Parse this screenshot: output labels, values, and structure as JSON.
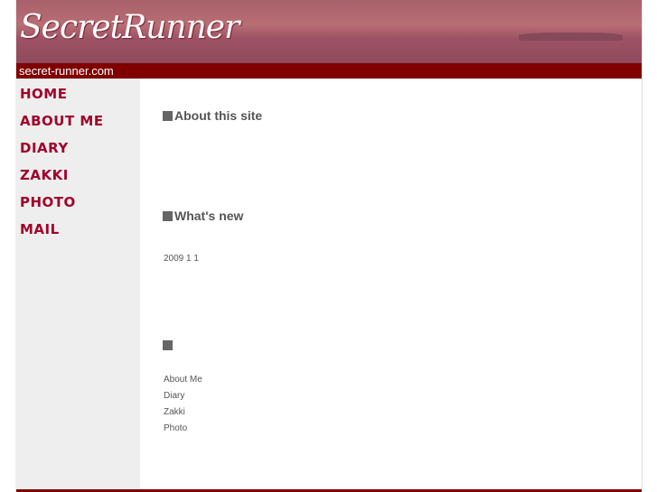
{
  "header": {
    "logo": "SecretRunner",
    "domain": "secret-runner.com"
  },
  "sidebar": {
    "items": [
      {
        "label": "HOME"
      },
      {
        "label": "ABOUT ME"
      },
      {
        "label": "DIARY"
      },
      {
        "label": "ZAKKI"
      },
      {
        "label": "PHOTO"
      },
      {
        "label": "MAIL"
      }
    ]
  },
  "main": {
    "about_title": "About this site",
    "news_title": "What's new",
    "news_date": "2009 1 1",
    "links_title": "",
    "links": [
      "About Me",
      "Diary",
      "Zakki",
      "Photo"
    ]
  },
  "colors": {
    "brand": "#800000",
    "nav": "#a0002a"
  }
}
